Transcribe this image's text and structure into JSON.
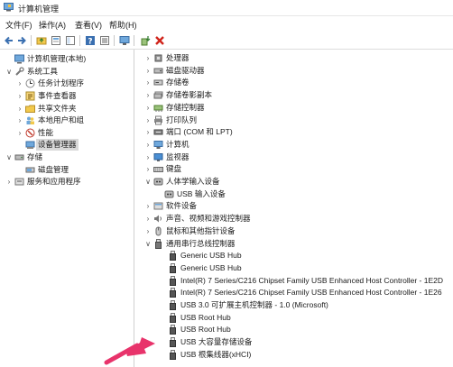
{
  "window": {
    "title": "计算机管理"
  },
  "menu": [
    "文件(F)",
    "操作(A)",
    "查看(V)",
    "帮助(H)"
  ],
  "toolbar": {
    "icons": [
      "back-icon",
      "forward-icon",
      "up-folder-icon",
      "properties-icon",
      "show-hide-tree-icon",
      "help-icon",
      "show-list-icon",
      "monitor-icon",
      "update-driver-icon",
      "uninstall-icon"
    ]
  },
  "left_tree": [
    {
      "label": "计算机管理(本地)",
      "expander": "",
      "icon": "computer-mgmt-icon"
    },
    {
      "label": "系统工具",
      "expander": "∨",
      "icon": "tools-icon"
    },
    {
      "label": "任务计划程序",
      "expander": "›",
      "icon": "clock-icon"
    },
    {
      "label": "事件查看器",
      "expander": "›",
      "icon": "event-viewer-icon"
    },
    {
      "label": "共享文件夹",
      "expander": "›",
      "icon": "shared-folder-icon"
    },
    {
      "label": "本地用户和组",
      "expander": "›",
      "icon": "users-icon"
    },
    {
      "label": "性能",
      "expander": "›",
      "icon": "performance-icon"
    },
    {
      "label": "设备管理器",
      "expander": "",
      "icon": "device-manager-icon"
    },
    {
      "label": "存储",
      "expander": "∨",
      "icon": "storage-icon"
    },
    {
      "label": "磁盘管理",
      "expander": "",
      "icon": "disk-mgmt-icon"
    },
    {
      "label": "服务和应用程序",
      "expander": "›",
      "icon": "services-icon"
    }
  ],
  "device_tree": [
    {
      "label": "处理器",
      "expander": "›",
      "icon": "processor-icon"
    },
    {
      "label": "磁盘驱动器",
      "expander": "›",
      "icon": "disk-drive-icon"
    },
    {
      "label": "存储卷",
      "expander": "›",
      "icon": "volume-icon"
    },
    {
      "label": "存储卷影副本",
      "expander": "›",
      "icon": "volume-shadow-icon"
    },
    {
      "label": "存储控制器",
      "expander": "›",
      "icon": "storage-controller-icon"
    },
    {
      "label": "打印队列",
      "expander": "›",
      "icon": "printer-icon"
    },
    {
      "label": "端口 (COM 和 LPT)",
      "expander": "›",
      "icon": "port-icon"
    },
    {
      "label": "计算机",
      "expander": "›",
      "icon": "computer-icon"
    },
    {
      "label": "监视器",
      "expander": "›",
      "icon": "monitor-icon"
    },
    {
      "label": "键盘",
      "expander": "›",
      "icon": "keyboard-icon"
    },
    {
      "label": "人体学输入设备",
      "expander": "∨",
      "icon": "hid-icon"
    },
    {
      "label": "USB 输入设备",
      "expander": "",
      "icon": "hid-icon"
    },
    {
      "label": "软件设备",
      "expander": "›",
      "icon": "software-device-icon"
    },
    {
      "label": "声音、视频和游戏控制器",
      "expander": "›",
      "icon": "speaker-icon"
    },
    {
      "label": "鼠标和其他指针设备",
      "expander": "›",
      "icon": "mouse-icon"
    },
    {
      "label": "通用串行总线控制器",
      "expander": "∨",
      "icon": "usb-icon"
    },
    {
      "label": "Generic USB Hub",
      "expander": "",
      "icon": "usb-plug-icon"
    },
    {
      "label": "Generic USB Hub",
      "expander": "",
      "icon": "usb-plug-icon"
    },
    {
      "label": "Intel(R) 7 Series/C216 Chipset Family USB Enhanced Host Controller - 1E2D",
      "expander": "",
      "icon": "usb-plug-icon"
    },
    {
      "label": "Intel(R) 7 Series/C216 Chipset Family USB Enhanced Host Controller - 1E26",
      "expander": "",
      "icon": "usb-plug-icon"
    },
    {
      "label": "USB 3.0 可扩展主机控制器 - 1.0 (Microsoft)",
      "expander": "",
      "icon": "usb-plug-icon"
    },
    {
      "label": "USB Root Hub",
      "expander": "",
      "icon": "usb-plug-icon"
    },
    {
      "label": "USB Root Hub",
      "expander": "",
      "icon": "usb-plug-icon"
    },
    {
      "label": "USB 大容量存储设备",
      "expander": "",
      "icon": "usb-plug-icon"
    },
    {
      "label": "USB 根集线器(xHCI)",
      "expander": "",
      "icon": "usb-plug-icon"
    }
  ],
  "colors": {
    "arrow": "#e8336b",
    "selection": "#d9d9d9"
  }
}
